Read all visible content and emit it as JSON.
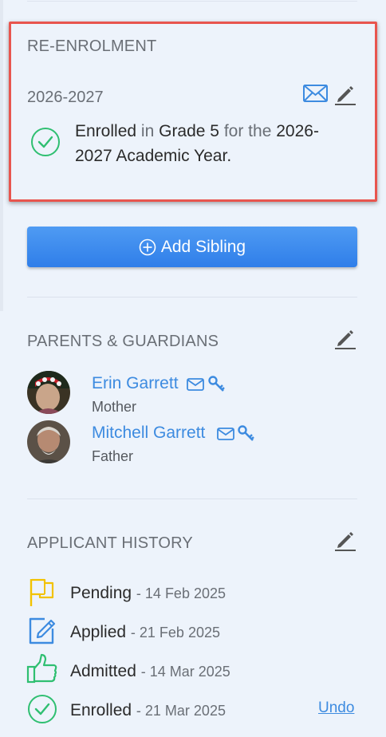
{
  "reenrolment": {
    "title": "RE-ENROLMENT",
    "year": "2026-2027",
    "status_strong": "Enrolled",
    "status_in": "in",
    "grade": "Grade 5",
    "for_the": "for the",
    "academic_year": "2026-2027 Academic Year."
  },
  "add_sibling": {
    "label": "Add Sibling"
  },
  "parents": {
    "title": "PARENTS & GUARDIANS",
    "items": [
      {
        "name": "Erin Garrett",
        "relation": "Mother"
      },
      {
        "name": "Mitchell Garrett",
        "relation": "Father"
      }
    ]
  },
  "history": {
    "title": "APPLICANT HISTORY",
    "items": [
      {
        "status": "Pending",
        "date": "- 14 Feb 2025",
        "icon": "flag-icon"
      },
      {
        "status": "Applied",
        "date": "- 21 Feb 2025",
        "icon": "edit-form-icon"
      },
      {
        "status": "Admitted",
        "date": "- 14 Mar 2025",
        "icon": "thumbs-up-icon"
      },
      {
        "status": "Enrolled",
        "date": "- 21 Mar 2025",
        "icon": "check-circle-icon"
      }
    ],
    "undo_label": "Undo"
  },
  "colors": {
    "accent_blue": "#3d8be0",
    "highlight_red": "#e8554e",
    "green": "#2fbf71",
    "yellow": "#f2c200"
  }
}
